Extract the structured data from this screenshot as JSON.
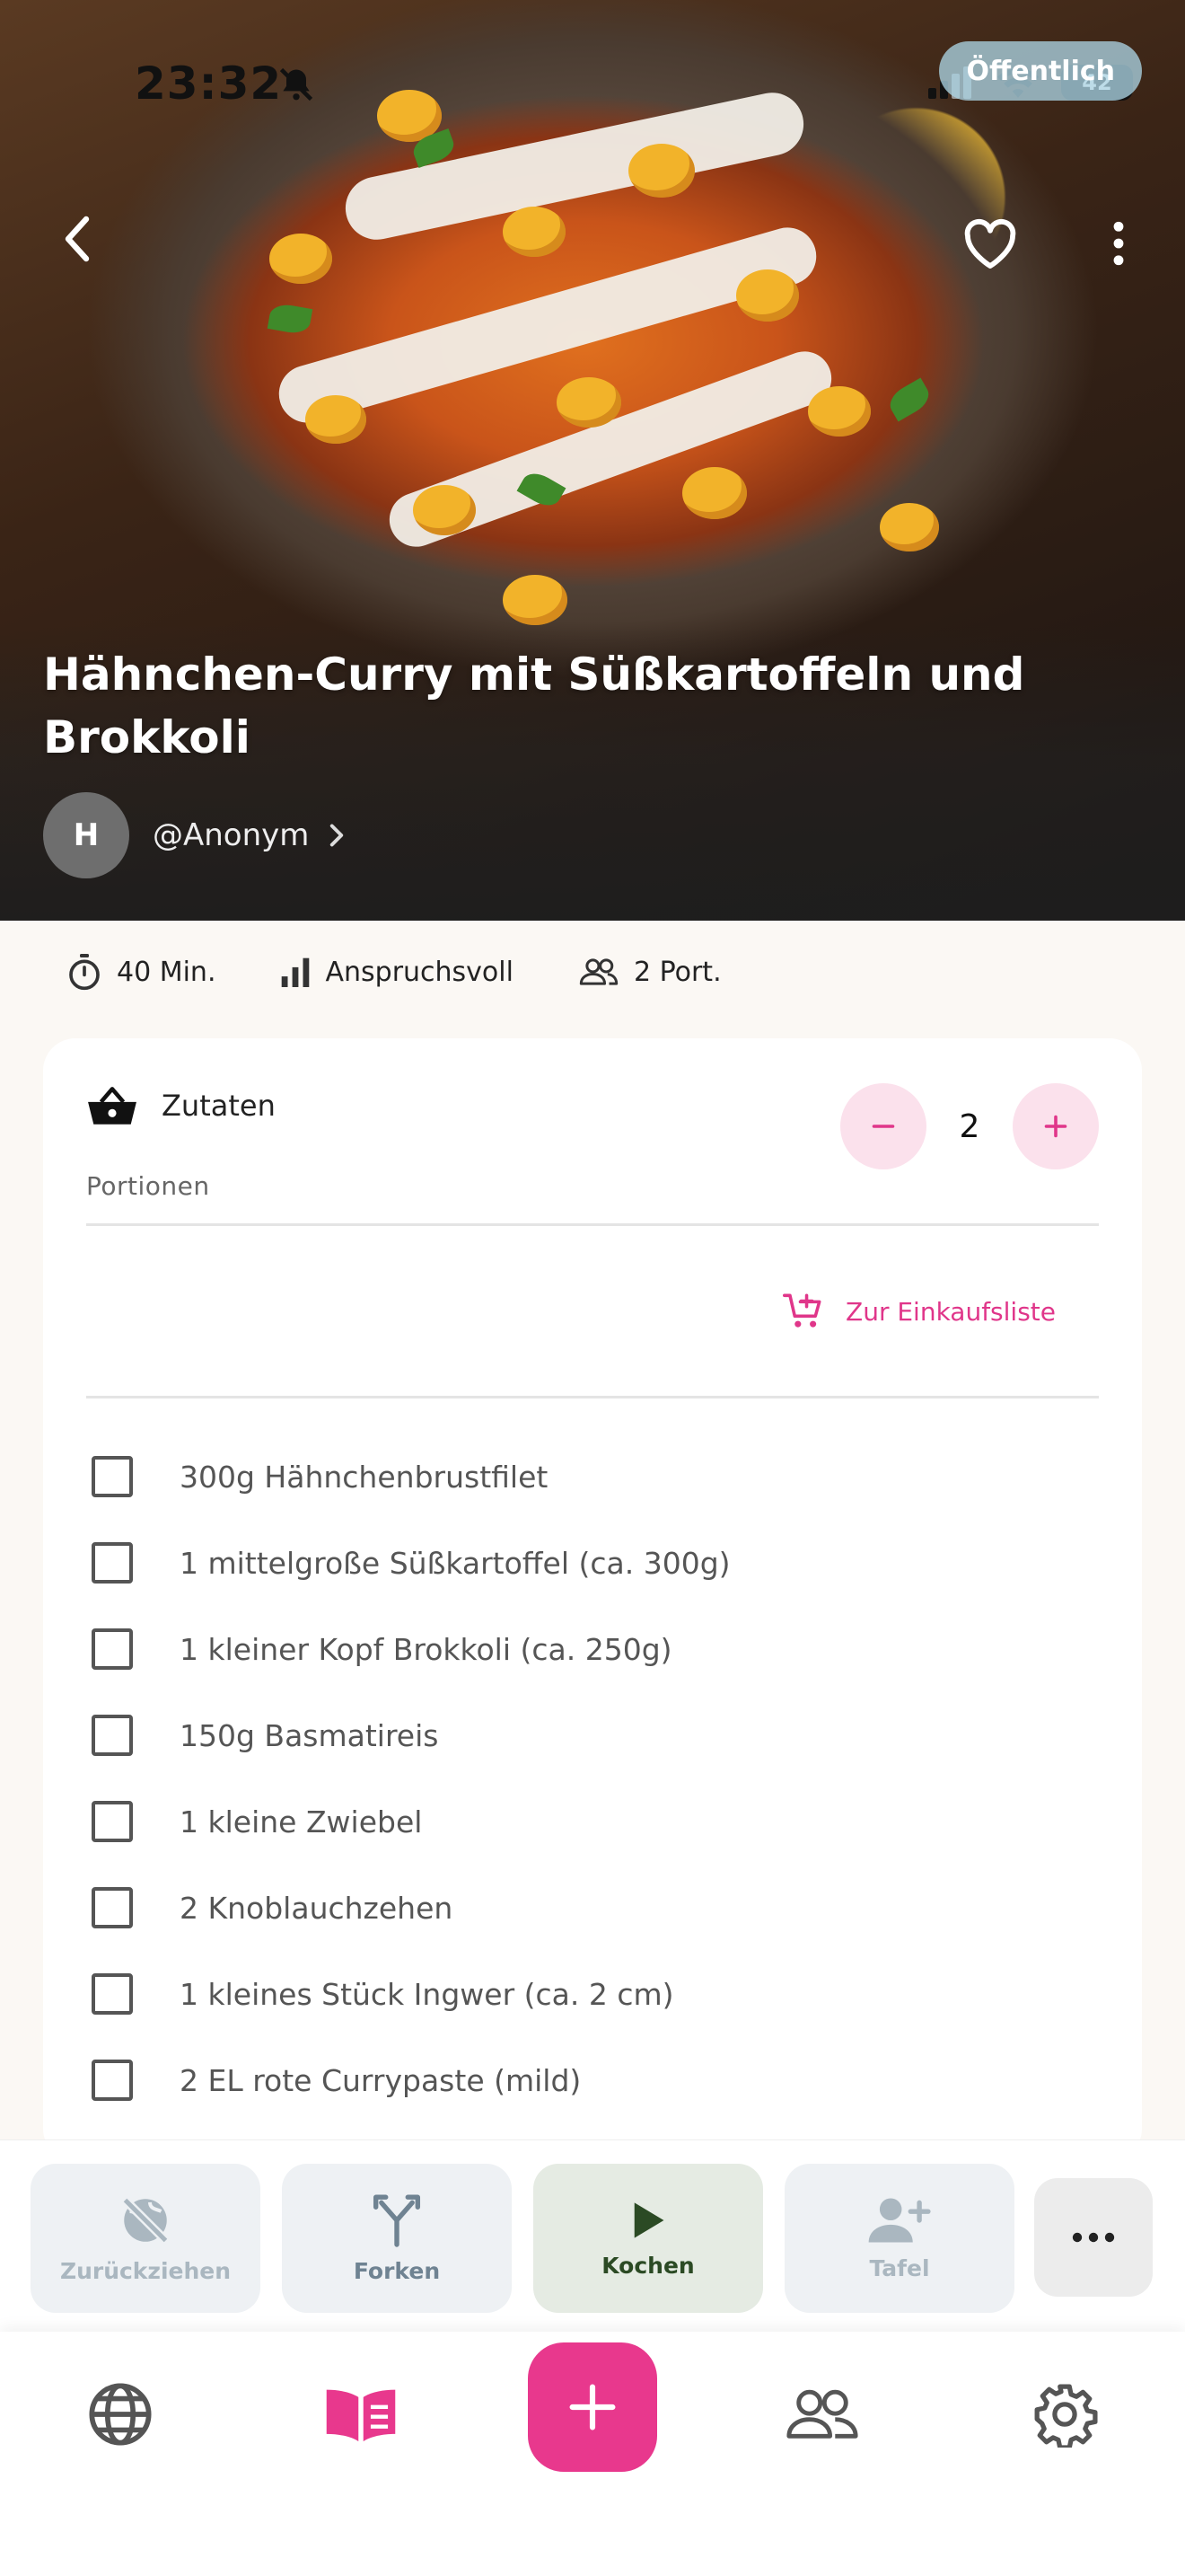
{
  "status_bar": {
    "time": "23:32",
    "battery": "42"
  },
  "hero": {
    "visibility_badge": "Öffentlich",
    "title": "Hähnchen-Curry mit Süßkartoffeln und Brokkoli",
    "author_initial": "H",
    "author_name": "@Anonym"
  },
  "meta": {
    "time": "40 Min.",
    "difficulty": "Anspruchsvoll",
    "portions": "2 Port."
  },
  "ingredients_card": {
    "title": "Zutaten",
    "portions_label": "Portionen",
    "portions_value": "2",
    "shopping_link": "Zur Einkaufsliste",
    "items": [
      "300g Hähnchenbrustfilet",
      "1 mittelgroße Süßkartoffel (ca. 300g)",
      "1 kleiner Kopf Brokkoli (ca. 250g)",
      "150g Basmatireis",
      "1 kleine Zwiebel",
      "2 Knoblauchzehen",
      "1 kleines Stück Ingwer (ca. 2 cm)",
      "2 EL rote Currypaste (mild)"
    ]
  },
  "actions": {
    "withdraw": "Zurückziehen",
    "fork": "Forken",
    "cook": "Kochen",
    "board": "Tafel"
  },
  "icons": {
    "back": "chevron-left-icon",
    "favorite": "heart-icon",
    "more": "more-vertical-icon",
    "timer": "timer-icon",
    "difficulty": "bar-chart-icon",
    "portions": "people-icon",
    "basket": "basket-icon",
    "cart": "cart-add-icon",
    "globe": "globe-icon",
    "book": "book-icon",
    "settings": "gear-icon"
  },
  "colors": {
    "accent": "#e8388d",
    "accent_soft": "#fbe1ec",
    "cook_bg": "#e5ebe3"
  }
}
